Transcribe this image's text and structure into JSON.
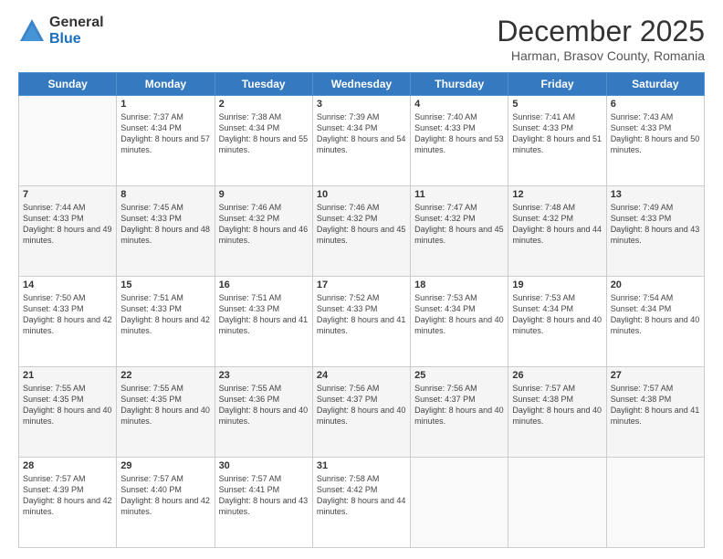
{
  "logo": {
    "general": "General",
    "blue": "Blue"
  },
  "header": {
    "month": "December 2025",
    "location": "Harman, Brasov County, Romania"
  },
  "weekdays": [
    "Sunday",
    "Monday",
    "Tuesday",
    "Wednesday",
    "Thursday",
    "Friday",
    "Saturday"
  ],
  "weeks": [
    [
      {
        "day": "",
        "sunrise": "",
        "sunset": "",
        "daylight": ""
      },
      {
        "day": "1",
        "sunrise": "Sunrise: 7:37 AM",
        "sunset": "Sunset: 4:34 PM",
        "daylight": "Daylight: 8 hours and 57 minutes."
      },
      {
        "day": "2",
        "sunrise": "Sunrise: 7:38 AM",
        "sunset": "Sunset: 4:34 PM",
        "daylight": "Daylight: 8 hours and 55 minutes."
      },
      {
        "day": "3",
        "sunrise": "Sunrise: 7:39 AM",
        "sunset": "Sunset: 4:34 PM",
        "daylight": "Daylight: 8 hours and 54 minutes."
      },
      {
        "day": "4",
        "sunrise": "Sunrise: 7:40 AM",
        "sunset": "Sunset: 4:33 PM",
        "daylight": "Daylight: 8 hours and 53 minutes."
      },
      {
        "day": "5",
        "sunrise": "Sunrise: 7:41 AM",
        "sunset": "Sunset: 4:33 PM",
        "daylight": "Daylight: 8 hours and 51 minutes."
      },
      {
        "day": "6",
        "sunrise": "Sunrise: 7:43 AM",
        "sunset": "Sunset: 4:33 PM",
        "daylight": "Daylight: 8 hours and 50 minutes."
      }
    ],
    [
      {
        "day": "7",
        "sunrise": "Sunrise: 7:44 AM",
        "sunset": "Sunset: 4:33 PM",
        "daylight": "Daylight: 8 hours and 49 minutes."
      },
      {
        "day": "8",
        "sunrise": "Sunrise: 7:45 AM",
        "sunset": "Sunset: 4:33 PM",
        "daylight": "Daylight: 8 hours and 48 minutes."
      },
      {
        "day": "9",
        "sunrise": "Sunrise: 7:46 AM",
        "sunset": "Sunset: 4:32 PM",
        "daylight": "Daylight: 8 hours and 46 minutes."
      },
      {
        "day": "10",
        "sunrise": "Sunrise: 7:46 AM",
        "sunset": "Sunset: 4:32 PM",
        "daylight": "Daylight: 8 hours and 45 minutes."
      },
      {
        "day": "11",
        "sunrise": "Sunrise: 7:47 AM",
        "sunset": "Sunset: 4:32 PM",
        "daylight": "Daylight: 8 hours and 45 minutes."
      },
      {
        "day": "12",
        "sunrise": "Sunrise: 7:48 AM",
        "sunset": "Sunset: 4:32 PM",
        "daylight": "Daylight: 8 hours and 44 minutes."
      },
      {
        "day": "13",
        "sunrise": "Sunrise: 7:49 AM",
        "sunset": "Sunset: 4:33 PM",
        "daylight": "Daylight: 8 hours and 43 minutes."
      }
    ],
    [
      {
        "day": "14",
        "sunrise": "Sunrise: 7:50 AM",
        "sunset": "Sunset: 4:33 PM",
        "daylight": "Daylight: 8 hours and 42 minutes."
      },
      {
        "day": "15",
        "sunrise": "Sunrise: 7:51 AM",
        "sunset": "Sunset: 4:33 PM",
        "daylight": "Daylight: 8 hours and 42 minutes."
      },
      {
        "day": "16",
        "sunrise": "Sunrise: 7:51 AM",
        "sunset": "Sunset: 4:33 PM",
        "daylight": "Daylight: 8 hours and 41 minutes."
      },
      {
        "day": "17",
        "sunrise": "Sunrise: 7:52 AM",
        "sunset": "Sunset: 4:33 PM",
        "daylight": "Daylight: 8 hours and 41 minutes."
      },
      {
        "day": "18",
        "sunrise": "Sunrise: 7:53 AM",
        "sunset": "Sunset: 4:34 PM",
        "daylight": "Daylight: 8 hours and 40 minutes."
      },
      {
        "day": "19",
        "sunrise": "Sunrise: 7:53 AM",
        "sunset": "Sunset: 4:34 PM",
        "daylight": "Daylight: 8 hours and 40 minutes."
      },
      {
        "day": "20",
        "sunrise": "Sunrise: 7:54 AM",
        "sunset": "Sunset: 4:34 PM",
        "daylight": "Daylight: 8 hours and 40 minutes."
      }
    ],
    [
      {
        "day": "21",
        "sunrise": "Sunrise: 7:55 AM",
        "sunset": "Sunset: 4:35 PM",
        "daylight": "Daylight: 8 hours and 40 minutes."
      },
      {
        "day": "22",
        "sunrise": "Sunrise: 7:55 AM",
        "sunset": "Sunset: 4:35 PM",
        "daylight": "Daylight: 8 hours and 40 minutes."
      },
      {
        "day": "23",
        "sunrise": "Sunrise: 7:55 AM",
        "sunset": "Sunset: 4:36 PM",
        "daylight": "Daylight: 8 hours and 40 minutes."
      },
      {
        "day": "24",
        "sunrise": "Sunrise: 7:56 AM",
        "sunset": "Sunset: 4:37 PM",
        "daylight": "Daylight: 8 hours and 40 minutes."
      },
      {
        "day": "25",
        "sunrise": "Sunrise: 7:56 AM",
        "sunset": "Sunset: 4:37 PM",
        "daylight": "Daylight: 8 hours and 40 minutes."
      },
      {
        "day": "26",
        "sunrise": "Sunrise: 7:57 AM",
        "sunset": "Sunset: 4:38 PM",
        "daylight": "Daylight: 8 hours and 40 minutes."
      },
      {
        "day": "27",
        "sunrise": "Sunrise: 7:57 AM",
        "sunset": "Sunset: 4:38 PM",
        "daylight": "Daylight: 8 hours and 41 minutes."
      }
    ],
    [
      {
        "day": "28",
        "sunrise": "Sunrise: 7:57 AM",
        "sunset": "Sunset: 4:39 PM",
        "daylight": "Daylight: 8 hours and 42 minutes."
      },
      {
        "day": "29",
        "sunrise": "Sunrise: 7:57 AM",
        "sunset": "Sunset: 4:40 PM",
        "daylight": "Daylight: 8 hours and 42 minutes."
      },
      {
        "day": "30",
        "sunrise": "Sunrise: 7:57 AM",
        "sunset": "Sunset: 4:41 PM",
        "daylight": "Daylight: 8 hours and 43 minutes."
      },
      {
        "day": "31",
        "sunrise": "Sunrise: 7:58 AM",
        "sunset": "Sunset: 4:42 PM",
        "daylight": "Daylight: 8 hours and 44 minutes."
      },
      {
        "day": "",
        "sunrise": "",
        "sunset": "",
        "daylight": ""
      },
      {
        "day": "",
        "sunrise": "",
        "sunset": "",
        "daylight": ""
      },
      {
        "day": "",
        "sunrise": "",
        "sunset": "",
        "daylight": ""
      }
    ]
  ]
}
